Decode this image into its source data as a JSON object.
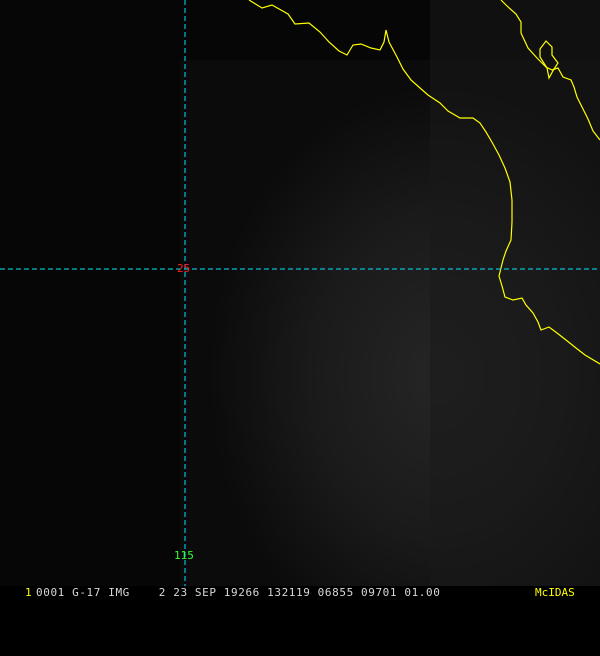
{
  "colors": {
    "background": "#050505",
    "coastline": "#ffff00",
    "gridline": "#00e5ff",
    "latitude_label": "#ff2020",
    "longitude_label": "#33ff33",
    "frame_number": "#ffff00",
    "status_text": "#d8d8d8",
    "logo": "#ffff00"
  },
  "map": {
    "latitude_label": "25",
    "longitude_label": "115"
  },
  "status_bar": {
    "frame_number": "1",
    "text": "0001 G-17 IMG    2 23 SEP 19266 132119 06855 09701 01.00",
    "logo": "McIDAS"
  }
}
